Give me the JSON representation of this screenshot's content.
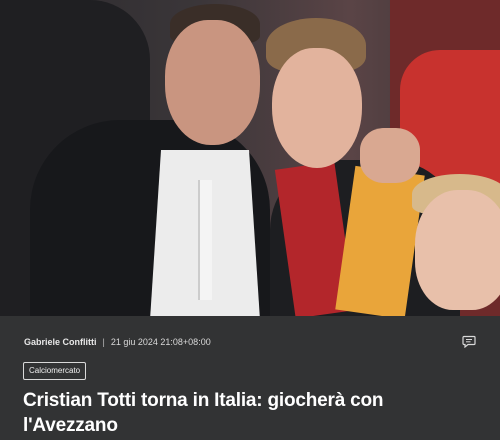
{
  "article": {
    "author": "Gabriele Conflitti",
    "separator": "|",
    "date": "21 giu 2024 21:08+08:00",
    "category": "Calciomercato",
    "title": "Cristian Totti torna in Italia: giocherà con l'Avezzano"
  },
  "icons": {
    "comment": "comment-icon"
  },
  "colors": {
    "background": "#323334",
    "text": "#ffffff"
  }
}
